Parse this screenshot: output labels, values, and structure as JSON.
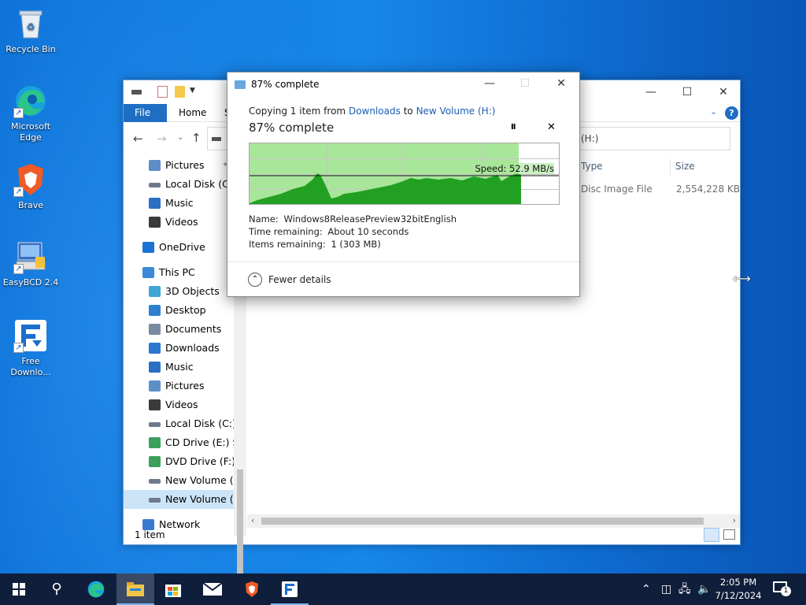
{
  "desktop": {
    "icons": [
      {
        "label": "Recycle Bin",
        "icon": "recycle-bin-icon"
      },
      {
        "label": "Microsoft Edge",
        "icon": "edge-icon"
      },
      {
        "label": "Brave",
        "icon": "brave-icon"
      },
      {
        "label": "EasyBCD 2.4",
        "icon": "easybcd-icon"
      },
      {
        "label": "Free Downlo...",
        "icon": "free-download-manager-icon"
      }
    ]
  },
  "explorer": {
    "tabs": [
      "File",
      "Home",
      "S"
    ],
    "address_text": "(H:)",
    "columns": [
      "Type",
      "Size"
    ],
    "file": {
      "type": "Disc Image File",
      "size": "2,554,228 KB"
    },
    "nav_items": [
      {
        "label": "Pictures",
        "icon": "pictures-icon",
        "pinned": true
      },
      {
        "label": "Local Disk (C:)",
        "icon": "drive-icon"
      },
      {
        "label": "Music",
        "icon": "music-icon"
      },
      {
        "label": "Videos",
        "icon": "videos-icon"
      },
      {
        "label": "OneDrive",
        "icon": "onedrive-icon"
      },
      {
        "label": "This PC",
        "icon": "this-pc-icon"
      },
      {
        "label": "3D Objects",
        "icon": "3d-objects-icon"
      },
      {
        "label": "Desktop",
        "icon": "desktop-folder-icon"
      },
      {
        "label": "Documents",
        "icon": "documents-icon"
      },
      {
        "label": "Downloads",
        "icon": "downloads-icon"
      },
      {
        "label": "Music",
        "icon": "music-icon"
      },
      {
        "label": "Pictures",
        "icon": "pictures-icon"
      },
      {
        "label": "Videos",
        "icon": "videos-icon"
      },
      {
        "label": "Local Disk (C:)",
        "icon": "drive-icon"
      },
      {
        "label": "CD Drive (E:) SSS",
        "icon": "cd-drive-icon"
      },
      {
        "label": "DVD Drive (F:) H",
        "icon": "dvd-drive-icon"
      },
      {
        "label": "New Volume (G:",
        "icon": "drive-icon"
      },
      {
        "label": "New Volume (H:",
        "icon": "drive-icon",
        "selected": true
      },
      {
        "label": "Network",
        "icon": "network-icon"
      }
    ],
    "status": "1 item"
  },
  "dialog": {
    "title": "87% complete",
    "copy_prefix": "Copying 1 item from",
    "source": "Downloads",
    "to": "to",
    "destination": "New Volume (H:)",
    "progress_label": "87% complete",
    "progress": 0.87,
    "speed": "Speed: 52.9 MB/s",
    "name_label": "Name:",
    "name_value": "Windows8ReleasePreview32bitEnglish",
    "time_label": "Time remaining:",
    "time_value": "About 10 seconds",
    "items_label": "Items remaining:",
    "items_value": "1 (303 MB)",
    "fewer_details": "Fewer details",
    "pause_glyph": "II",
    "close_glyph": "✕"
  },
  "taskbar": {
    "time": "2:05 PM",
    "date": "7/12/2024",
    "notification_count": "1"
  },
  "colors": {
    "link": "#1a5fb4",
    "graph_fill": "#a8e69a",
    "graph_series": "#22a022",
    "accent": "#0a6fd6"
  }
}
